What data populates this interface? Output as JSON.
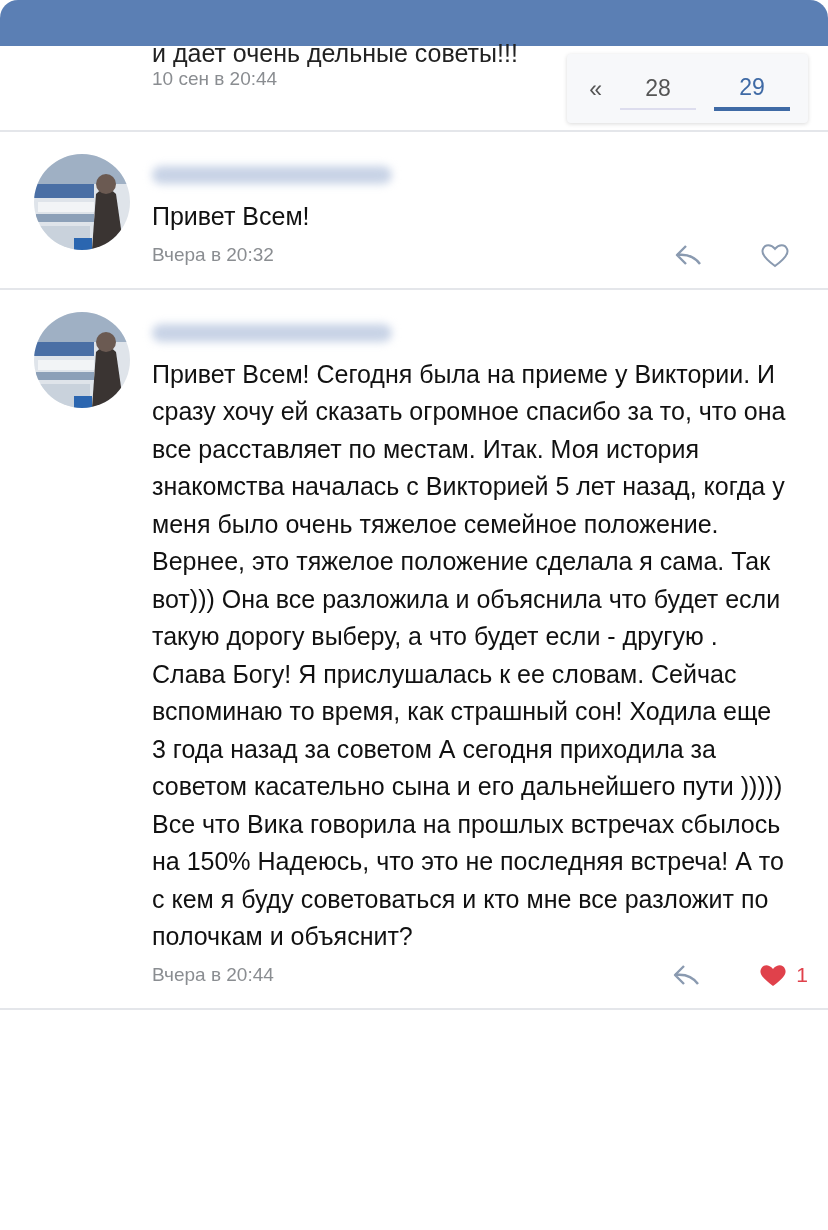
{
  "previous_comment": {
    "text": "и дает очень дельные советы!!!",
    "date": "10 сен в 20:44"
  },
  "pagination": {
    "first": "«",
    "pages": [
      {
        "label": "28",
        "selected": false
      },
      {
        "label": "29",
        "selected": true
      }
    ]
  },
  "comments": [
    {
      "text": "Привет Всем!",
      "date": "Вчера в 20:32",
      "liked": false
    },
    {
      "text": "Привет Всем! Сегодня была на приеме у Виктории. И сразу хочу ей сказать огромное спасибо за то, что она все расставляет по местам. Итак. Моя история знакомства началась с Викторией 5 лет назад, когда у меня было очень тяжелое семейное положение. Вернее, это тяжелое положение сделала я сама. Так вот))) Она все разложила и объяснила что будет если такую дорогу выберу, а что будет если - другую . Слава Богу! Я прислушалась к ее словам. Сейчас вспоминаю то время, как страшный сон! Ходила еще 3 года назад за советом А сегодня приходила за советом касательно сына и его дальнейшего пути ))))) Все что Вика говорила на прошлых встречах сбылось на 150% Надеюсь, что это не последняя встреча! А то с кем я буду советоваться и кто мне все разложит по полочкам и объяснит?",
      "date": "Вчера в 20:44",
      "liked": true,
      "like_count": "1"
    }
  ]
}
